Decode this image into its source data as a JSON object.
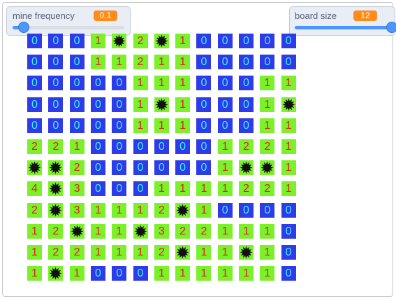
{
  "monitors": {
    "mine_frequency": {
      "label": "mine frequency",
      "value": "0.1",
      "fraction": 0.1
    },
    "board_size": {
      "label": "board size",
      "value": "12",
      "fraction": 1.0
    }
  },
  "colors": {
    "blue_cell": "#2e3be8",
    "blue_text": "#3ff2f2",
    "green_cell": "#7cf02a",
    "green_text": "#e0201c",
    "mine": "#111111",
    "slider": "#4c97ff",
    "value_badge": "#ff8c1a"
  },
  "board": {
    "rows": [
      [
        "0",
        "0",
        "0",
        "1",
        "*",
        "2",
        "*",
        "1",
        "0",
        "0",
        "0",
        "0",
        "0"
      ],
      [
        "0",
        "0",
        "0",
        "1",
        "1",
        "2",
        "1",
        "1",
        "0",
        "0",
        "0",
        "0",
        "0"
      ],
      [
        "0",
        "0",
        "0",
        "0",
        "0",
        "1",
        "1",
        "1",
        "0",
        "0",
        "0",
        "1",
        "1"
      ],
      [
        "0",
        "0",
        "0",
        "0",
        "0",
        "1",
        "*",
        "1",
        "0",
        "0",
        "0",
        "1",
        "*"
      ],
      [
        "0",
        "0",
        "0",
        "0",
        "0",
        "1",
        "1",
        "1",
        "0",
        "0",
        "0",
        "1",
        "1"
      ],
      [
        "2",
        "2",
        "1",
        "0",
        "0",
        "0",
        "0",
        "0",
        "0",
        "1",
        "2",
        "2",
        "1"
      ],
      [
        "*",
        "*",
        "2",
        "0",
        "0",
        "0",
        "0",
        "0",
        "0",
        "1",
        "*",
        "*",
        "1"
      ],
      [
        "4",
        "*",
        "3",
        "0",
        "0",
        "0",
        "1",
        "1",
        "1",
        "1",
        "2",
        "2",
        "1"
      ],
      [
        "2",
        "*",
        "3",
        "1",
        "1",
        "1",
        "2",
        "*",
        "1",
        "0",
        "0",
        "0",
        "0"
      ],
      [
        "1",
        "2",
        "*",
        "1",
        "1",
        "*",
        "3",
        "2",
        "2",
        "1",
        "1",
        "1",
        "0"
      ],
      [
        "1",
        "2",
        "2",
        "1",
        "1",
        "1",
        "2",
        "*",
        "1",
        "1",
        "*",
        "1",
        "0"
      ],
      [
        "1",
        "*",
        "1",
        "0",
        "0",
        "0",
        "1",
        "1",
        "1",
        "1",
        "1",
        "1",
        "0"
      ]
    ]
  }
}
